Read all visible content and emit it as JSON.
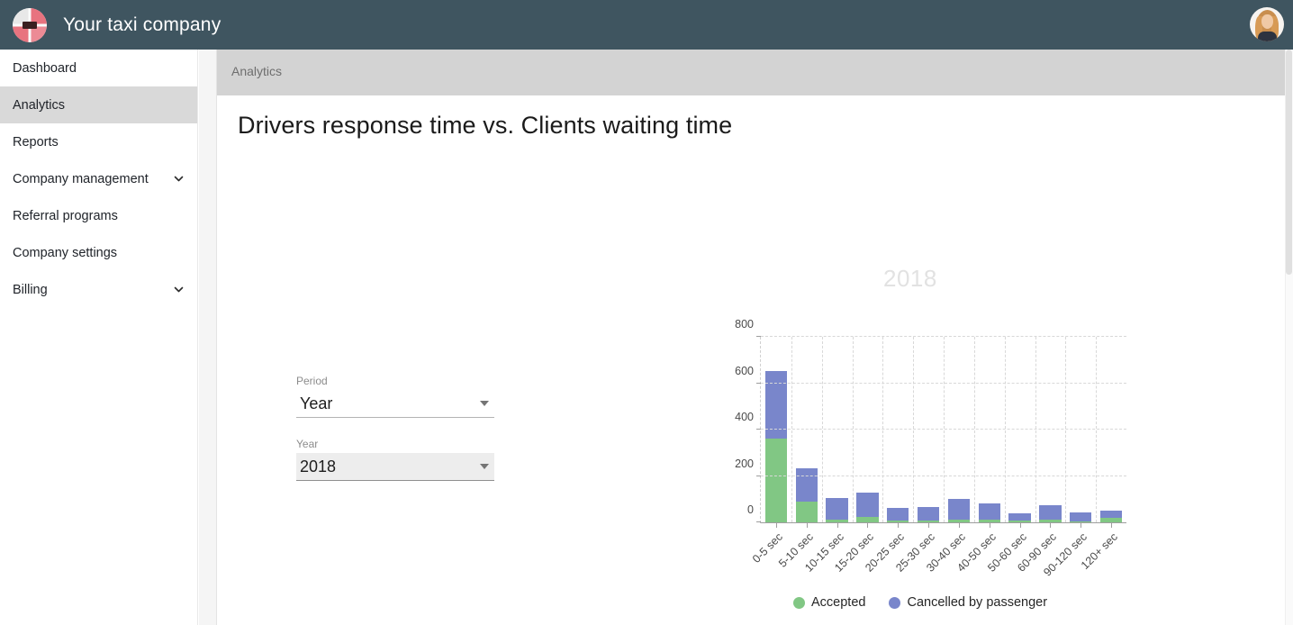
{
  "topbar": {
    "brand_title": "Your taxi company",
    "logo_icon": "taxi-logo-icon",
    "user_avatar_icon": "user-avatar-icon"
  },
  "sidebar": {
    "items": [
      {
        "label": "Dashboard",
        "active": false,
        "expandable": false
      },
      {
        "label": "Analytics",
        "active": true,
        "expandable": false
      },
      {
        "label": "Reports",
        "active": false,
        "expandable": false
      },
      {
        "label": "Company management",
        "active": false,
        "expandable": true,
        "chevron_icon": "chevron-down-icon"
      },
      {
        "label": "Referral programs",
        "active": false,
        "expandable": false
      },
      {
        "label": "Company settings",
        "active": false,
        "expandable": false
      },
      {
        "label": "Billing",
        "active": false,
        "expandable": true,
        "chevron_icon": "chevron-down-icon"
      }
    ]
  },
  "subheader": {
    "breadcrumb": "Analytics"
  },
  "card": {
    "title": "Drivers response time vs. Clients waiting time"
  },
  "controls": {
    "period": {
      "label": "Period",
      "value": "Year",
      "caret_icon": "dropdown-caret-icon"
    },
    "year": {
      "label": "Year",
      "value": "2018",
      "caret_icon": "dropdown-caret-icon"
    }
  },
  "chart_data": {
    "type": "bar",
    "stacked": true,
    "title": "",
    "subtitle": "2018",
    "xlabel": "",
    "ylabel": "",
    "ylim": [
      0,
      800
    ],
    "yticks": [
      0,
      200,
      400,
      600,
      800
    ],
    "grid": true,
    "legend_position": "bottom",
    "categories": [
      "0-5 sec",
      "5-10 sec",
      "10-15 sec",
      "15-20 sec",
      "20-25 sec",
      "25-30 sec",
      "30-40 sec",
      "40-50 sec",
      "50-60 sec",
      "60-90 sec",
      "90-120 sec",
      "120+ sec"
    ],
    "series": [
      {
        "name": "Accepted",
        "color": "#81c784",
        "values": [
          362,
          90,
          12,
          25,
          8,
          8,
          10,
          10,
          6,
          12,
          5,
          18
        ]
      },
      {
        "name": "Cancelled by passenger",
        "color": "#7986cb",
        "values": [
          292,
          145,
          93,
          105,
          54,
          60,
          90,
          70,
          32,
          60,
          37,
          32
        ]
      }
    ],
    "totals": [
      654,
      235,
      105,
      130,
      62,
      68,
      100,
      80,
      38,
      72,
      42,
      50
    ]
  },
  "legend": [
    {
      "label": "Accepted",
      "color": "#81c784"
    },
    {
      "label": "Cancelled by passenger",
      "color": "#7986cb"
    }
  ]
}
